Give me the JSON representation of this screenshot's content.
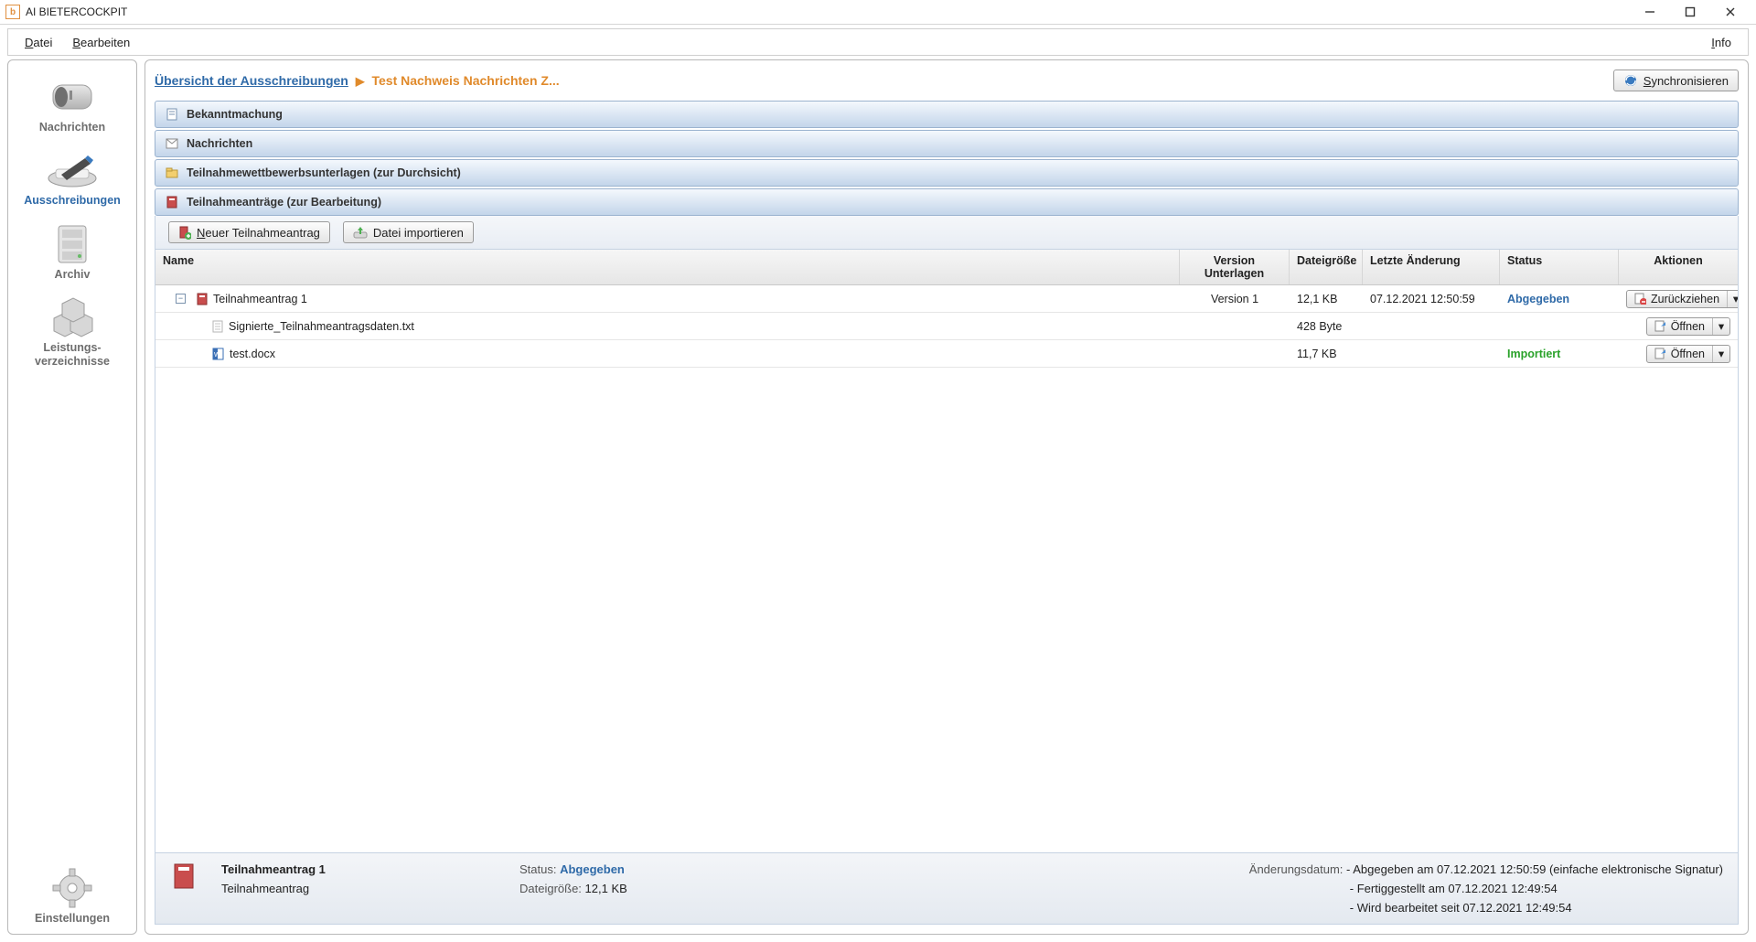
{
  "window": {
    "title": "AI BIETERCOCKPIT"
  },
  "menu": {
    "datei": "Datei",
    "bearbeiten": "Bearbeiten",
    "info": "Info"
  },
  "sidebar": {
    "items": [
      {
        "label": "Nachrichten"
      },
      {
        "label": "Ausschreibungen"
      },
      {
        "label": "Archiv"
      },
      {
        "label": "Leistungs-\nverzeichnisse"
      },
      {
        "label": "Einstellungen"
      }
    ]
  },
  "breadcrumb": {
    "root": "Übersicht der Ausschreibungen",
    "current": "Test Nachweis Nachrichten Z..."
  },
  "sync_btn": "Synchronisieren",
  "sections": {
    "bekanntmachung": "Bekanntmachung",
    "nachrichten": "Nachrichten",
    "unterlagen": "Teilnahmewettbewerbsunterlagen (zur Durchsicht)",
    "antraege": "Teilnahmeanträge (zur Bearbeitung)"
  },
  "toolbar": {
    "neuer": "Neuer Teilnahmeantrag",
    "import": "Datei importieren"
  },
  "table": {
    "headers": {
      "name": "Name",
      "version": "Version Unterlagen",
      "size": "Dateigröße",
      "date": "Letzte Änderung",
      "status": "Status",
      "actions": "Aktionen"
    },
    "rows": [
      {
        "kind": "parent",
        "name": "Teilnahmeantrag 1",
        "version": "Version 1",
        "size": "12,1 KB",
        "date": "07.12.2021 12:50:59",
        "status": "Abgegeben",
        "status_class": "blue",
        "action": "Zurückziehen"
      },
      {
        "kind": "child",
        "name": "Signierte_Teilnahmeantragsdaten.txt",
        "version": "",
        "size": "428 Byte",
        "date": "",
        "status": "",
        "status_class": "",
        "action": "Öffnen"
      },
      {
        "kind": "child",
        "name": "test.docx",
        "version": "",
        "size": "11,7 KB",
        "date": "",
        "status": "Importiert",
        "status_class": "green",
        "action": "Öffnen"
      }
    ]
  },
  "footer": {
    "title": "Teilnahmeantrag 1",
    "subtitle": "Teilnahmeantrag",
    "status_label": "Status:",
    "status_value": "Abgegeben",
    "size_label": "Dateigröße:",
    "size_value": "12,1 KB",
    "changes_label": "Änderungsdatum:",
    "changes": [
      "- Abgegeben am 07.12.2021 12:50:59 (einfache elektronische Signatur)",
      "- Fertiggestellt am 07.12.2021 12:49:54",
      "- Wird bearbeitet seit 07.12.2021 12:49:54"
    ]
  }
}
